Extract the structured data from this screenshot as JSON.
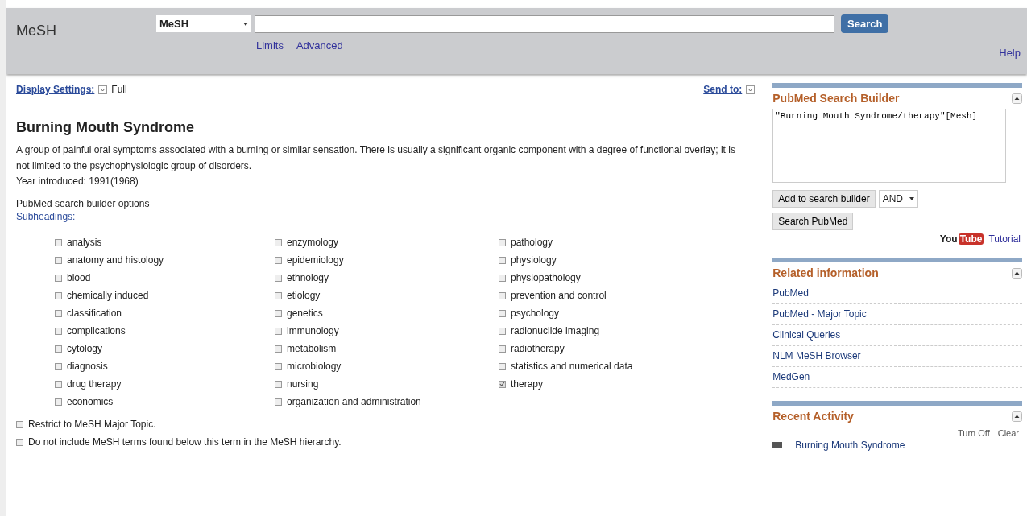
{
  "header": {
    "logo": "MeSH",
    "database": "MeSH",
    "search_button": "Search",
    "links": [
      "Limits",
      "Advanced"
    ],
    "help": "Help"
  },
  "display": {
    "settings": "Display Settings:",
    "format": "Full",
    "send_to": "Send to:"
  },
  "term": {
    "title": "Burning Mouth Syndrome",
    "description": "A group of painful oral symptoms associated with a burning or similar sensation. There is usually a significant organic component with a degree of functional overlay; it is not limited to the psychophysiologic group of disorders.",
    "year": "Year introduced: 1991(1968)"
  },
  "builder_options": {
    "label": "PubMed search builder options",
    "subheadings_link": "Subheadings:"
  },
  "subheadings": [
    [
      {
        "label": "analysis",
        "checked": false
      },
      {
        "label": "anatomy and histology",
        "checked": false
      },
      {
        "label": "blood",
        "checked": false
      },
      {
        "label": "chemically induced",
        "checked": false
      },
      {
        "label": "classification",
        "checked": false
      },
      {
        "label": "complications",
        "checked": false
      },
      {
        "label": "cytology",
        "checked": false
      },
      {
        "label": "diagnosis",
        "checked": false
      },
      {
        "label": "drug therapy",
        "checked": false
      },
      {
        "label": "economics",
        "checked": false
      }
    ],
    [
      {
        "label": "enzymology",
        "checked": false
      },
      {
        "label": "epidemiology",
        "checked": false
      },
      {
        "label": "ethnology",
        "checked": false
      },
      {
        "label": "etiology",
        "checked": false
      },
      {
        "label": "genetics",
        "checked": false
      },
      {
        "label": "immunology",
        "checked": false
      },
      {
        "label": "metabolism",
        "checked": false
      },
      {
        "label": "microbiology",
        "checked": false
      },
      {
        "label": "nursing",
        "checked": false
      },
      {
        "label": "organization and administration",
        "checked": false
      }
    ],
    [
      {
        "label": "pathology",
        "checked": false
      },
      {
        "label": "physiology",
        "checked": false
      },
      {
        "label": "physiopathology",
        "checked": false
      },
      {
        "label": "prevention and control",
        "checked": false
      },
      {
        "label": "psychology",
        "checked": false
      },
      {
        "label": "radionuclide imaging",
        "checked": false
      },
      {
        "label": "radiotherapy",
        "checked": false
      },
      {
        "label": "statistics and numerical data",
        "checked": false
      },
      {
        "label": "therapy",
        "checked": true
      }
    ]
  ],
  "options": [
    {
      "label": "Restrict to MeSH Major Topic.",
      "checked": false
    },
    {
      "label": "Do not include MeSH terms found below this term in the MeSH hierarchy.",
      "checked": false
    }
  ],
  "sidebar": {
    "search_builder": {
      "title": "PubMed Search Builder",
      "query": "\"Burning Mouth Syndrome/therapy\"[Mesh]",
      "add_button": "Add to search builder",
      "operator": "AND",
      "search_button": "Search PubMed",
      "tutorial_logo": [
        "You",
        "Tube"
      ],
      "tutorial": "Tutorial"
    },
    "related": {
      "title": "Related information",
      "items": [
        "PubMed",
        "PubMed - Major Topic",
        "Clinical Queries",
        "NLM MeSH Browser",
        "MedGen"
      ]
    },
    "recent": {
      "title": "Recent Activity",
      "actions": [
        "Turn Off",
        "Clear"
      ],
      "items": [
        "Burning Mouth Syndrome"
      ]
    }
  }
}
